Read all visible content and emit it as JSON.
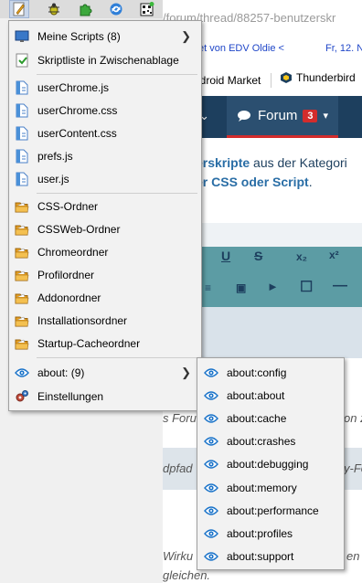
{
  "page": {
    "url_fragment": "/forum/thread/88257-benutzerskr",
    "notification_left": "tet von EDV Oldie <",
    "notification_right": "Fr, 12. N",
    "bookmark_android": "ndroid Market",
    "bookmark_thunderbird": "Thunderbird",
    "nav_forum_label": "Forum",
    "nav_forum_badge": "3",
    "info_part1": "erskripte",
    "info_part2": " aus der Kategori",
    "info_part3": "er CSS oder Script",
    "info_part4": ".",
    "line_1": "s Forum",
    "line_1b": "on z",
    "line_2": "dpfad",
    "line_2b": "y-Fo",
    "line_3": "Wirku",
    "line_3b": "en i",
    "line_4": "gleichen."
  },
  "toolbar": {
    "icons": [
      "script-editor-icon",
      "bug-icon",
      "puzzle-icon",
      "sync-icon",
      "qr-icon"
    ]
  },
  "menu": {
    "items": [
      {
        "label": "Meine Scripts (8)",
        "icon": "monitor-icon",
        "has_submenu": true
      },
      {
        "label": "Skriptliste in Zwischenablage",
        "icon": "clipboard-list-icon",
        "has_submenu": false
      },
      {
        "label": "userChrome.js",
        "icon": "doc-icon",
        "has_submenu": false
      },
      {
        "label": "userChrome.css",
        "icon": "doc-icon",
        "has_submenu": false
      },
      {
        "label": "userContent.css",
        "icon": "doc-icon",
        "has_submenu": false
      },
      {
        "label": "prefs.js",
        "icon": "doc-icon",
        "has_submenu": false
      },
      {
        "label": "user.js",
        "icon": "doc-icon",
        "has_submenu": false
      },
      {
        "label": "CSS-Ordner",
        "icon": "folder-icon",
        "has_submenu": false
      },
      {
        "label": "CSSWeb-Ordner",
        "icon": "folder-icon",
        "has_submenu": false
      },
      {
        "label": "Chromeordner",
        "icon": "folder-icon",
        "has_submenu": false
      },
      {
        "label": "Profilordner",
        "icon": "folder-icon",
        "has_submenu": false
      },
      {
        "label": "Addonordner",
        "icon": "folder-icon",
        "has_submenu": false
      },
      {
        "label": "Installationsordner",
        "icon": "folder-icon",
        "has_submenu": false
      },
      {
        "label": "Startup-Cacheordner",
        "icon": "folder-icon",
        "has_submenu": false
      },
      {
        "label": "about: (9)",
        "icon": "eye-icon",
        "has_submenu": true
      },
      {
        "label": "Einstellungen",
        "icon": "gears-icon",
        "has_submenu": false
      }
    ]
  },
  "submenu": {
    "items": [
      {
        "label": "about:config"
      },
      {
        "label": "about:about"
      },
      {
        "label": "about:cache"
      },
      {
        "label": "about:crashes"
      },
      {
        "label": "about:debugging"
      },
      {
        "label": "about:memory"
      },
      {
        "label": "about:performance"
      },
      {
        "label": "about:profiles"
      },
      {
        "label": "about:support"
      }
    ]
  },
  "colors": {
    "menu_bg": "#f2f2f2",
    "hover": "#91c9f7",
    "nav_bg": "#1d3f5e",
    "badge": "#d32c2c",
    "eye_blue": "#1a73c9",
    "folder_orange": "#e8a020"
  }
}
